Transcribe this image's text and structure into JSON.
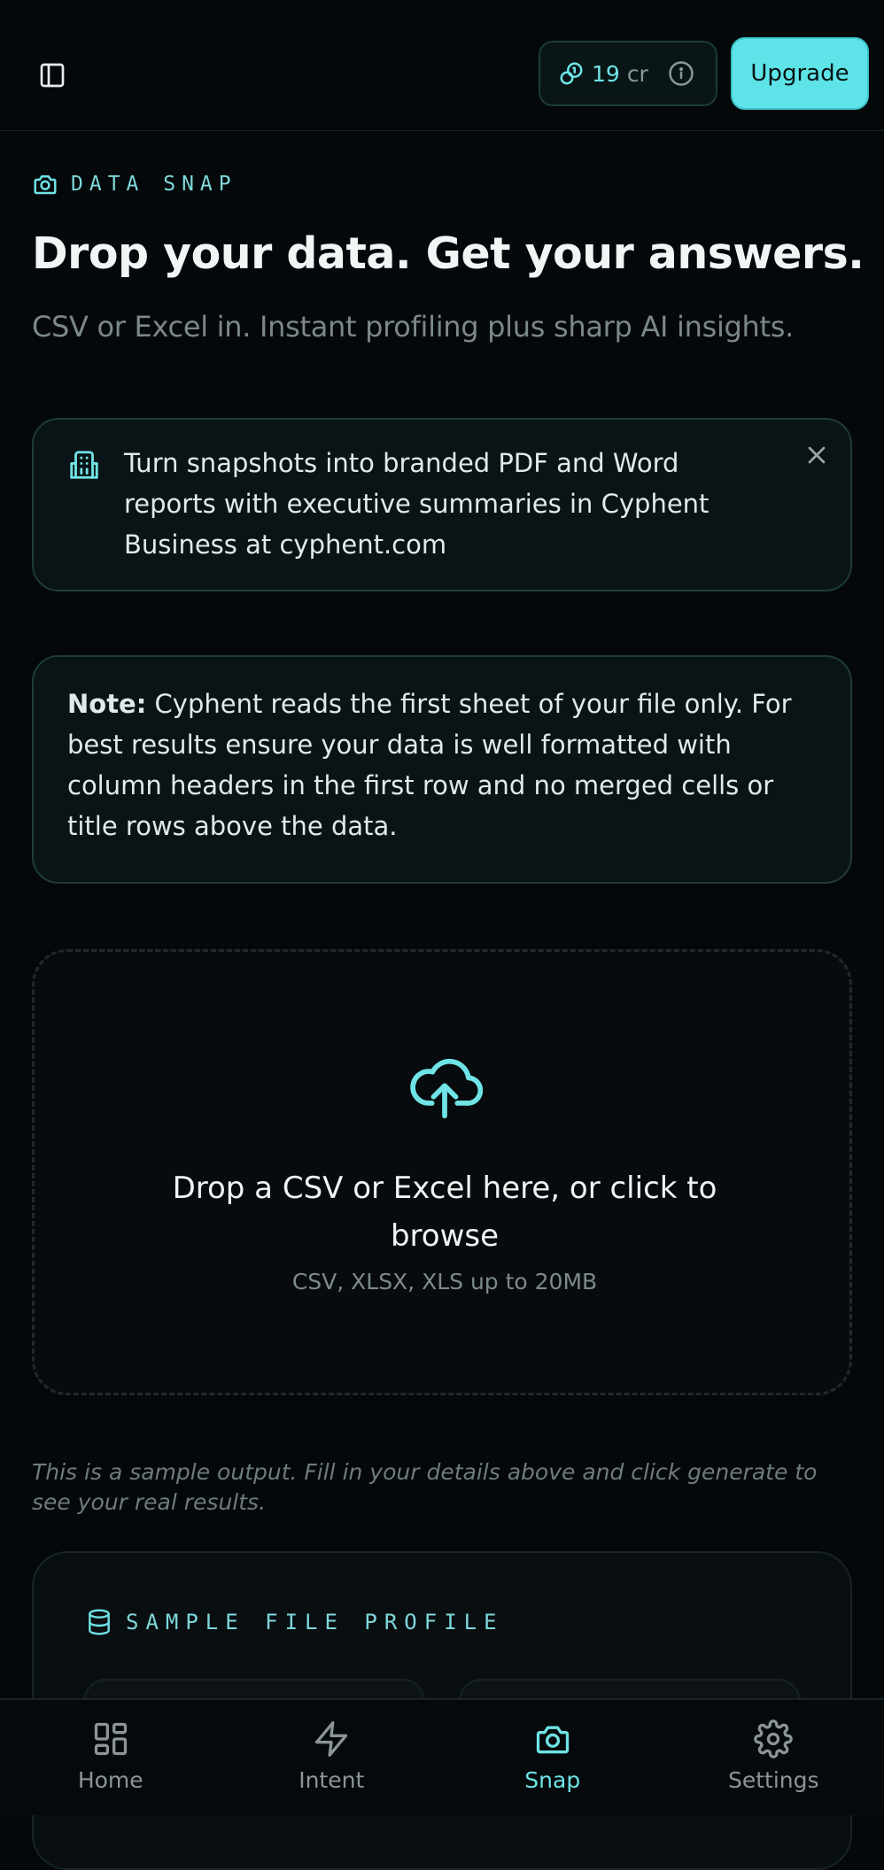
{
  "header": {
    "credits_value": "19",
    "credits_unit": "cr",
    "upgrade_label": "Upgrade"
  },
  "page": {
    "kicker": "DATA SNAP",
    "title": "Drop your data. Get your answers.",
    "subtitle": "CSV or Excel in. Instant profiling plus sharp AI insights."
  },
  "promo": {
    "text": "Turn snapshots into branded PDF and Word reports with executive summaries in Cyphent Business at cyphent.com"
  },
  "note": {
    "label": "Note:",
    "text": " Cyphent reads the first sheet of your file only. For best results ensure your data is well formatted with column headers in the first row and no merged cells or title rows above the data."
  },
  "dropzone": {
    "main": "Drop a CSV or Excel here, or click to browse",
    "sub": "CSV, XLSX, XLS up to 20MB"
  },
  "sample_note": "This is a sample output. Fill in your details above and click generate to see your real results.",
  "sample_profile": {
    "heading": "SAMPLE FILE PROFILE"
  },
  "nav": {
    "items": [
      {
        "label": "Home",
        "icon": "grid-icon",
        "active": false
      },
      {
        "label": "Intent",
        "icon": "bolt-icon",
        "active": false
      },
      {
        "label": "Snap",
        "icon": "camera-icon",
        "active": true
      },
      {
        "label": "Settings",
        "icon": "gear-icon",
        "active": false
      }
    ]
  },
  "colors": {
    "accent": "#5ee4e8",
    "background": "#04080a",
    "card_border": "#1f3a3c"
  }
}
